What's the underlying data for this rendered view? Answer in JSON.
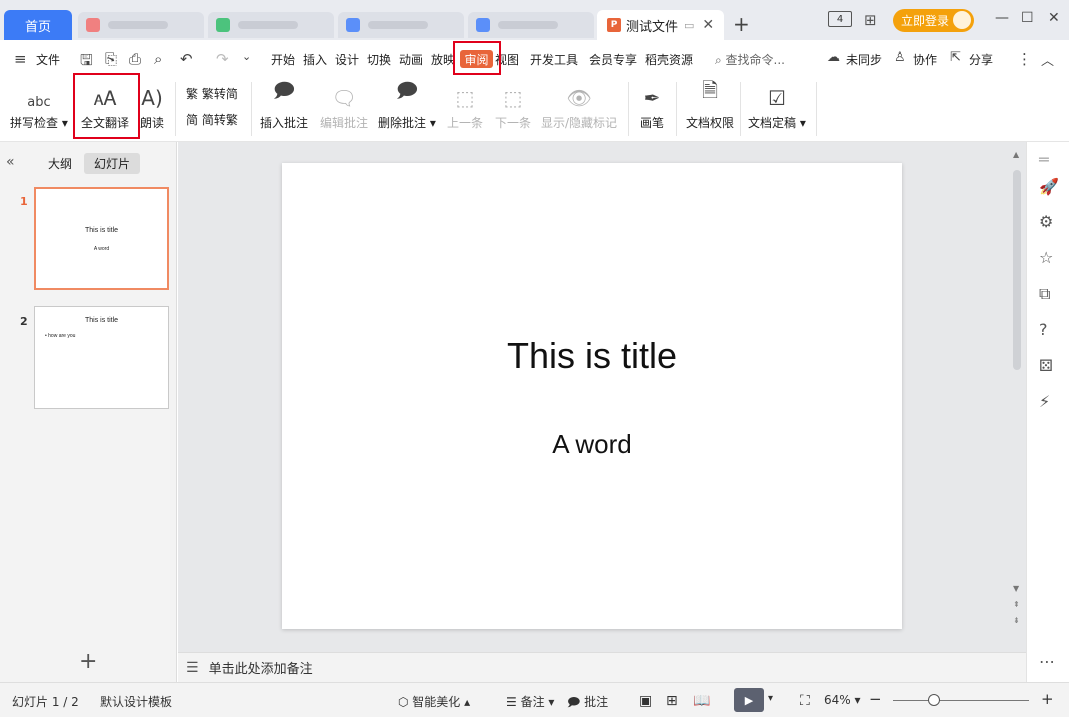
{
  "tabs": {
    "home": "首页",
    "doc_title": "测试文件",
    "doc_badge": "P",
    "login": "立即登录",
    "badge_count": "4"
  },
  "menu": {
    "file": "文件",
    "items": [
      "开始",
      "插入",
      "设计",
      "切换",
      "动画",
      "放映",
      "审阅",
      "视图",
      "开发工具",
      "会员专享",
      "稻壳资源"
    ],
    "search_placeholder": "查找命令...",
    "sync": "未同步",
    "collab": "协作",
    "share": "分享"
  },
  "ribbon": {
    "spell": "拼写检查",
    "translate": "全文翻译",
    "read": "朗读",
    "trad": "繁转简",
    "simp": "简转繁",
    "insert_comment": "插入批注",
    "edit_comment": "编辑批注",
    "delete_comment": "删除批注",
    "prev": "上一条",
    "next": "下一条",
    "show_hide": "显示/隐藏标记",
    "pen": "画笔",
    "perm": "文档权限",
    "final": "文档定稿",
    "abc": "abc"
  },
  "left_panel": {
    "outline_tab": "大纲",
    "slides_tab": "幻灯片",
    "thumbs": [
      {
        "num": "1",
        "title": "This is title",
        "sub": "A word"
      },
      {
        "num": "2",
        "title": "This is title",
        "bullet": "•  how are you"
      }
    ]
  },
  "slide": {
    "title": "This is title",
    "subtitle": "A word"
  },
  "notes_placeholder": "单击此处添加备注",
  "status": {
    "slide_count": "幻灯片 1 / 2",
    "template": "默认设计模板",
    "beautify": "智能美化",
    "notes": "备注",
    "comment": "批注",
    "zoom": "64%",
    "zoom_level": 0.3
  },
  "colors": {
    "accent_blue": "#3c7bf6",
    "review_orange": "#e8653a",
    "highlight_red": "#e0001b",
    "login_orange": "#f4a10c"
  }
}
